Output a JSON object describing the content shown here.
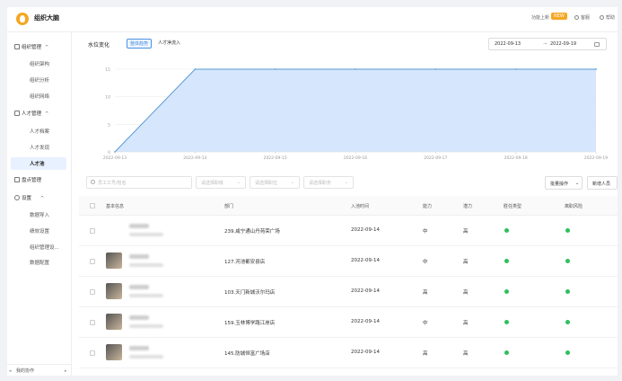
{
  "app": {
    "title": "组织大脑"
  },
  "topbar": {
    "update_label": "功能上新",
    "new_badge": "NEW",
    "service_label": "客服",
    "help_label": "帮助"
  },
  "sidebar": {
    "groups": [
      {
        "label": "组织管理",
        "caret": "^",
        "items": [
          "组织架构",
          "组织分析",
          "组织网络"
        ]
      },
      {
        "label": "人才管理",
        "caret": "^",
        "items": [
          "人才档案",
          "人才发现",
          "人才池"
        ]
      },
      {
        "label": "盘点管理",
        "caret": "",
        "items": []
      },
      {
        "label": "设置",
        "caret": "^",
        "items": [
          "数据导入",
          "绩效设置",
          "组织管理设...",
          "数据配置"
        ]
      }
    ],
    "active_item": "人才池",
    "footer_label": "我的协作"
  },
  "chart_card": {
    "title": "水位变化",
    "tabs": [
      {
        "label": "整体趋势",
        "active": true
      },
      {
        "label": "人才净流入",
        "active": false
      }
    ],
    "date_start": "2022-09-13",
    "date_separator": "→",
    "date_end": "2022-09-19"
  },
  "chart_data": {
    "type": "area",
    "x": [
      "2022-09-13",
      "2022-09-14",
      "2022-09-15",
      "2022-09-16",
      "2022-09-17",
      "2022-09-18",
      "2022-09-19"
    ],
    "values": [
      0,
      15,
      15,
      15,
      15,
      15,
      15
    ],
    "ylim": [
      0,
      15
    ],
    "yticks": [
      0,
      5,
      10,
      15
    ],
    "grid": true,
    "line_color": "#5b9bd5",
    "fill_color": "#cfe2fb"
  },
  "filters": {
    "search_placeholder": "员工工号/姓名",
    "selects": [
      "请选择职级",
      "请选择职位",
      "请选择职务"
    ],
    "batch_label": "批量操作",
    "add_label": "新增人员"
  },
  "table": {
    "headers": [
      "基本信息",
      "部门",
      "入池时间",
      "能力",
      "潜力",
      "胜任类型",
      "离职风险"
    ],
    "rows": [
      {
        "dept": "239.咸宁通山丹苑荣广场",
        "date": "2022-09-14",
        "ability": "中",
        "potential": "高",
        "avatar": false
      },
      {
        "dept": "127.河池都安县店",
        "date": "2022-09-14",
        "ability": "中",
        "potential": "高",
        "avatar": true
      },
      {
        "dept": "103.天门新城沃尔玛店",
        "date": "2022-09-14",
        "ability": "高",
        "potential": "高",
        "avatar": true
      },
      {
        "dept": "159.玉林博学路江岸店",
        "date": "2022-09-14",
        "ability": "中",
        "potential": "高",
        "avatar": true
      },
      {
        "dept": "145.防城恒富广场店",
        "date": "2022-09-14",
        "ability": "高",
        "potential": "高",
        "avatar": true
      }
    ],
    "status_color": "#2ec05c"
  }
}
